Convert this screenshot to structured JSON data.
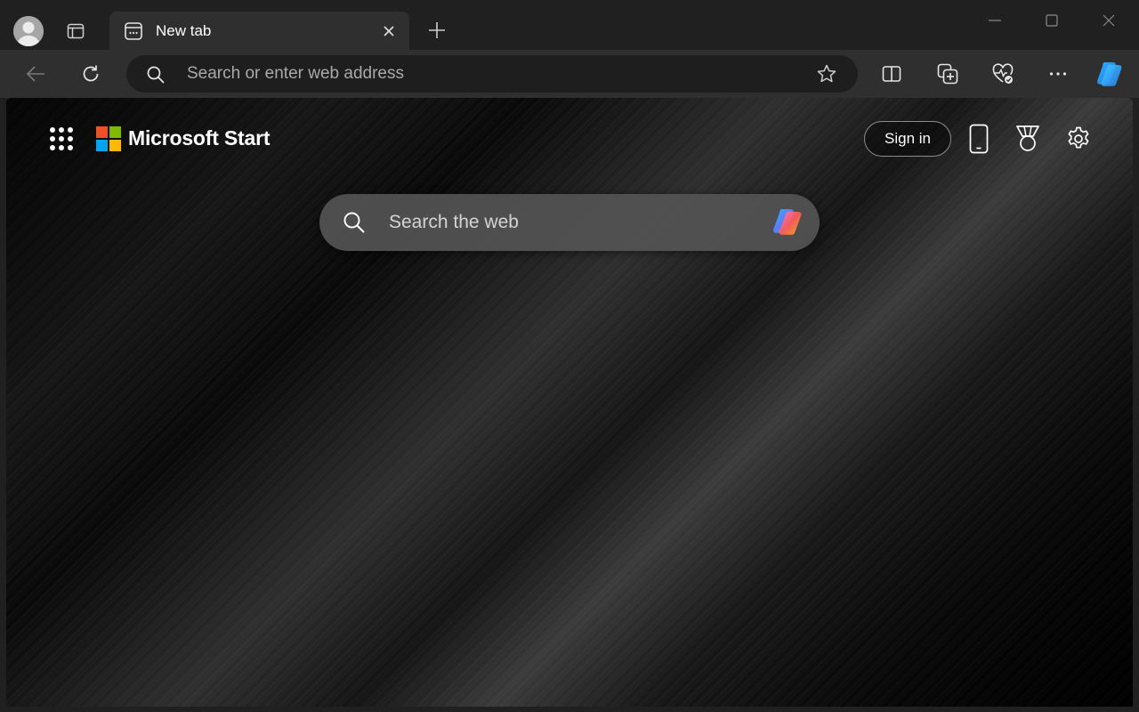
{
  "window": {
    "tab": {
      "title": "New tab"
    }
  },
  "toolbar": {
    "address_placeholder": "Search or enter web address"
  },
  "page": {
    "brand": "Microsoft Start",
    "sign_in_label": "Sign in",
    "search_placeholder": "Search the web"
  },
  "colors": {
    "tabstrip_bg": "#202020",
    "toolbar_bg": "#2f2f2f",
    "address_bar_bg": "#1e1e1e",
    "ms_logo": [
      "#f25022",
      "#7fba00",
      "#00a4ef",
      "#ffb900"
    ]
  },
  "icons": {
    "profile": "person-icon",
    "tab_actions": "tab-actions-icon",
    "tab_favicon": "new-tab-icon",
    "tab_close": "close-icon",
    "new_tab": "plus-icon",
    "back": "arrow-left-icon",
    "refresh": "refresh-icon",
    "address_search": "search-icon",
    "favorite": "star-icon",
    "split_screen": "split-screen-icon",
    "collections": "collections-icon",
    "browser_essentials": "heart-pulse-icon",
    "more": "ellipsis-icon",
    "copilot": "copilot-icon",
    "apps": "app-launcher-icon",
    "phone": "phone-icon",
    "rewards": "rewards-medal-icon",
    "settings": "gear-icon"
  }
}
